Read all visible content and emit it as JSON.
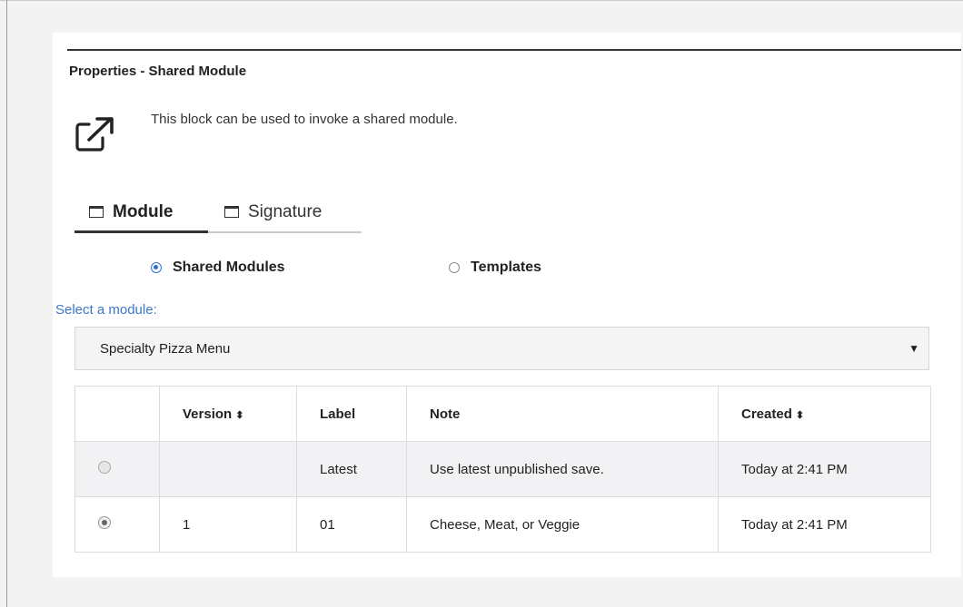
{
  "panel": {
    "title": "Properties - Shared Module",
    "description": "This block can be used to invoke a shared module.",
    "icon": "external-link-icon"
  },
  "tabs": [
    {
      "label": "Module",
      "active": true,
      "icon": "tab-window-icon"
    },
    {
      "label": "Signature",
      "active": false,
      "icon": "tab-window-icon"
    }
  ],
  "source_options": [
    {
      "label": "Shared Modules",
      "selected": true
    },
    {
      "label": "Templates",
      "selected": false
    }
  ],
  "module_select": {
    "label": "Select a module:",
    "value": "Specialty Pizza Menu"
  },
  "versions_table": {
    "columns": [
      "",
      "Version",
      "Label",
      "Note",
      "Created"
    ],
    "sortable": [
      "Version",
      "Created"
    ],
    "rows": [
      {
        "selected": false,
        "version": "",
        "label": "Latest",
        "note": "Use latest unpublished save.",
        "created": "Today at 2:41 PM"
      },
      {
        "selected": true,
        "version": "1",
        "label": "01",
        "note": "Cheese, Meat, or Veggie",
        "created": "Today at 2:41 PM"
      }
    ]
  },
  "colors": {
    "accent": "#2e6fd1",
    "label_blue": "#3c78c8",
    "panel_bg": "#ffffff",
    "page_bg": "#f3f3f3"
  }
}
